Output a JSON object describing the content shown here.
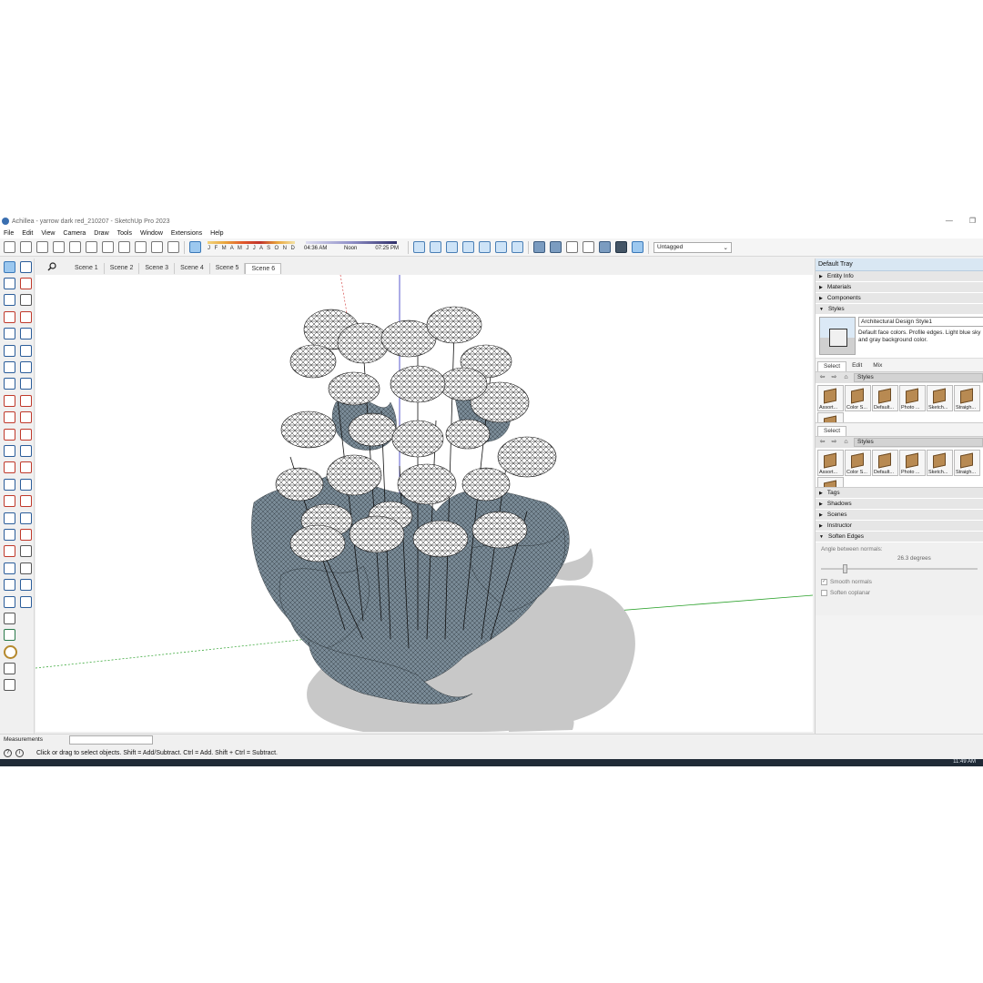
{
  "window": {
    "title": "Achillea - yarrow dark red_210207 - SketchUp Pro 2023",
    "minimize_glyph": "—",
    "restore_glyph": "❐"
  },
  "menu": [
    "File",
    "Edit",
    "View",
    "Camera",
    "Draw",
    "Tools",
    "Window",
    "Extensions",
    "Help"
  ],
  "shadows": {
    "months": "J F M A M J J A S O N D",
    "time_start": "04:36 AM",
    "time_mid": "Noon",
    "time_end": "07:25 PM"
  },
  "tag_dropdown": {
    "value": "Untagged",
    "arrow": "⌄"
  },
  "scenes": {
    "tabs": [
      "Scene 1",
      "Scene 2",
      "Scene 3",
      "Scene 4",
      "Scene 5",
      "Scene 6"
    ],
    "active_index": 5
  },
  "tray": {
    "title": "Default Tray",
    "sections_top": [
      "Entity Info",
      "Materials",
      "Components"
    ],
    "styles_section": "Styles",
    "style_name": "Architectural Design Style1",
    "style_description": "Default face colors. Profile edges. Light blue sky and gray background color.",
    "select_tab": "Select",
    "edit_tab": "Edit",
    "mix_tab": "Mix",
    "library_label": "Styles",
    "style_thumbs": [
      "Assort...",
      "Color S...",
      "Default...",
      "Photo ...",
      "Sketch...",
      "Straigh..."
    ],
    "sections_bottom": [
      "Tags",
      "Shadows",
      "Scenes",
      "Instructor"
    ],
    "soften_section": "Soften Edges",
    "angle_label": "Angle between normals:",
    "angle_value": "26.3  degrees",
    "angle_slider_fraction": 0.146,
    "smooth_normals_label": "Smooth normals",
    "smooth_normals_checked": true,
    "soften_coplanar_label": "Soften coplanar",
    "soften_coplanar_checked": false
  },
  "measurements": {
    "label": "Measurements",
    "value": ""
  },
  "status": {
    "message": "Click or drag to select objects. Shift = Add/Subtract. Ctrl = Add. Shift + Ctrl = Subtract."
  },
  "taskbar": {
    "clock": "11:49 AM"
  },
  "colors": {
    "red_axis": "#d03030",
    "green_axis": "#28a028",
    "blue_axis": "#3030c0",
    "tray_header": "#d9e7f3",
    "leaf": "#6d7f8c",
    "shadow": "#c8c8c8"
  }
}
